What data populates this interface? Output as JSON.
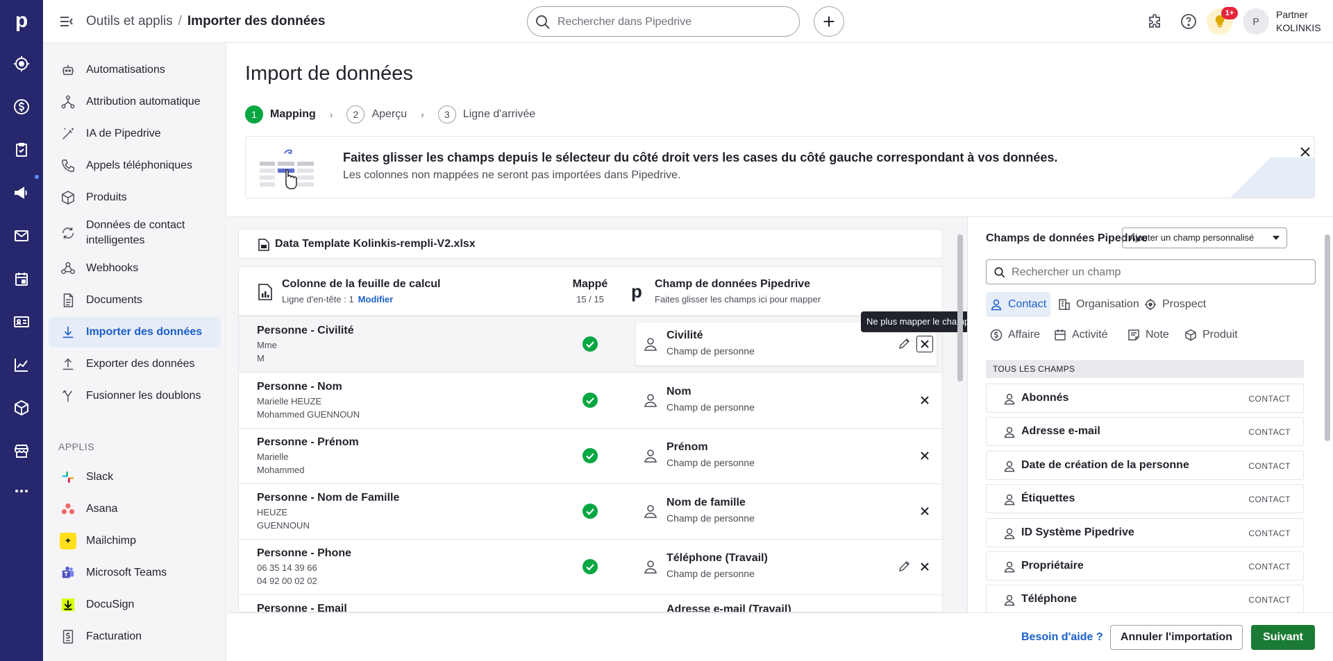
{
  "topbar": {
    "breadcrumb_parent": "Outils et applis",
    "breadcrumb_sep": "/",
    "breadcrumb_current": "Importer des données",
    "search_placeholder": "Rechercher dans Pipedrive",
    "notification_badge": "1+",
    "avatar_initial": "P",
    "account_line1": "Partner",
    "account_line2": "KOLINKIS"
  },
  "rail": {
    "logo": "p",
    "icons": [
      "target-icon",
      "dollar-icon",
      "clipboard-check-icon",
      "megaphone-icon",
      "mail-icon",
      "calendar-icon",
      "contact-card-icon",
      "chart-line-icon",
      "box-icon",
      "store-icon",
      "more-icon"
    ]
  },
  "sidebar": {
    "items": [
      {
        "label": "Automatisations",
        "icon": "robot-icon"
      },
      {
        "label": "Attribution automatique",
        "icon": "hierarchy-icon"
      },
      {
        "label": "IA de Pipedrive",
        "icon": "magic-wand-icon"
      },
      {
        "label": "Appels téléphoniques",
        "icon": "phone-icon"
      },
      {
        "label": "Produits",
        "icon": "box-icon"
      },
      {
        "label": "Données de contact intelligentes",
        "icon": "refresh-icon"
      },
      {
        "label": "Webhooks",
        "icon": "webhook-icon"
      },
      {
        "label": "Documents",
        "icon": "document-icon"
      },
      {
        "label": "Importer des données",
        "icon": "download-icon",
        "active": true
      },
      {
        "label": "Exporter des données",
        "icon": "upload-icon"
      },
      {
        "label": "Fusionner les doublons",
        "icon": "merge-icon"
      }
    ],
    "apps_heading": "APPLIS",
    "apps": [
      {
        "label": "Slack",
        "icon": "slack-icon"
      },
      {
        "label": "Asana",
        "icon": "asana-icon"
      },
      {
        "label": "Mailchimp",
        "icon": "mailchimp-icon"
      },
      {
        "label": "Microsoft Teams",
        "icon": "teams-icon"
      },
      {
        "label": "DocuSign",
        "icon": "docusign-icon"
      },
      {
        "label": "Facturation",
        "icon": "invoice-icon"
      }
    ]
  },
  "main": {
    "title": "Import de données",
    "steps": [
      {
        "num": "1",
        "label": "Mapping",
        "active": true
      },
      {
        "num": "2",
        "label": "Aperçu"
      },
      {
        "num": "3",
        "label": "Ligne d'arrivée"
      }
    ],
    "banner": {
      "title": "Faites glisser les champs depuis le sélecteur du côté droit vers les cases du côté gauche correspondant à vos données.",
      "subtitle": "Les colonnes non mappées ne seront pas importées dans Pipedrive."
    },
    "file_name": "Data Template Kolinkis-rempli-V2.xlsx",
    "table_header": {
      "col1": "Colonne de la feuille de calcul",
      "col1_sub": "Ligne d'en-tête : 1",
      "col1_link": "Modifier",
      "col2": "Mappé",
      "col2_sub": "15 / 15",
      "col3_logo": "p",
      "col3": "Champ de données Pipedrive",
      "col3_sub": "Faites glisser les champs ici pour mapper"
    },
    "rows": [
      {
        "title": "Personne - Civilité",
        "s1": "Mme",
        "s2": "M",
        "field": "Civilité",
        "ftype": "Champ de personne"
      },
      {
        "title": "Personne - Nom",
        "s1": "Marielle HEUZE",
        "s2": "Mohammed GUENNOUN",
        "field": "Nom",
        "ftype": "Champ de personne"
      },
      {
        "title": "Personne - Prénom",
        "s1": "Marielle",
        "s2": "Mohammed",
        "field": "Prénom",
        "ftype": "Champ de personne"
      },
      {
        "title": "Personne - Nom de Famille",
        "s1": "HEUZE",
        "s2": "GUENNOUN",
        "field": "Nom de famille",
        "ftype": "Champ de personne"
      },
      {
        "title": "Personne - Phone",
        "s1": "06 35 14 39 66",
        "s2": "04 92 00 02 02",
        "field": "Téléphone (Travail)",
        "ftype": "Champ de personne"
      },
      {
        "title": "Personne - Email",
        "s1": "",
        "s2": "",
        "field": "Adresse e-mail (Travail)",
        "ftype": ""
      }
    ],
    "tooltip": "Ne plus mapper le champ"
  },
  "right_panel": {
    "title": "Champs de données Pipedrive",
    "add_custom": "Ajouter un champ personnalisé",
    "search_placeholder": "Rechercher un champ",
    "tabs": [
      {
        "label": "Contact",
        "icon": "person-icon",
        "active": true
      },
      {
        "label": "Organisation",
        "icon": "building-icon"
      },
      {
        "label": "Prospect",
        "icon": "target-icon"
      },
      {
        "label": "Affaire",
        "icon": "dollar-icon"
      },
      {
        "label": "Activité",
        "icon": "calendar-icon"
      },
      {
        "label": "Note",
        "icon": "note-icon"
      },
      {
        "label": "Produit",
        "icon": "box-icon"
      }
    ],
    "section": "TOUS LES CHAMPS",
    "fields": [
      {
        "label": "Abonnés",
        "tag": "CONTACT"
      },
      {
        "label": "Adresse e-mail",
        "tag": "CONTACT"
      },
      {
        "label": "Date de création de la personne",
        "tag": "CONTACT"
      },
      {
        "label": "Étiquettes",
        "tag": "CONTACT"
      },
      {
        "label": "ID Système Pipedrive",
        "tag": "CONTACT"
      },
      {
        "label": "Propriétaire",
        "tag": "CONTACT"
      },
      {
        "label": "Téléphone",
        "tag": "CONTACT"
      }
    ]
  },
  "footer": {
    "help": "Besoin d'aide ?",
    "cancel": "Annuler l'importation",
    "next": "Suivant"
  },
  "colors": {
    "rail": "#26276c",
    "accent_blue": "#1a5fc7",
    "success_green": "#08a742",
    "primary_button": "#1b7b34"
  }
}
